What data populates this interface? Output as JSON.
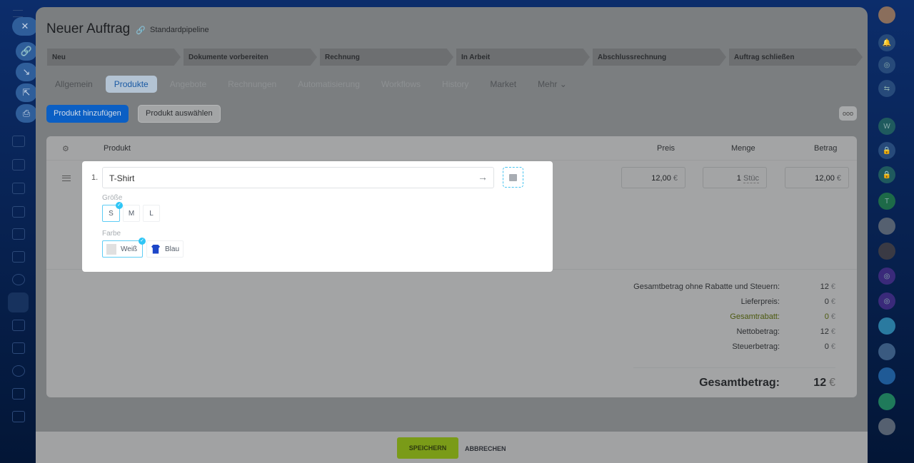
{
  "header": {
    "title": "Neuer Auftrag",
    "pipeline": "Standardpipeline"
  },
  "stages": [
    "Neu",
    "Dokumente vorbereiten",
    "Rechnung",
    "In Arbeit",
    "Abschlussrechnung",
    "Auftrag schließen"
  ],
  "tabs": [
    {
      "label": "Allgemein"
    },
    {
      "label": "Produkte"
    },
    {
      "label": "Angebote"
    },
    {
      "label": "Rechnungen"
    },
    {
      "label": "Automatisierung"
    },
    {
      "label": "Workflows"
    },
    {
      "label": "History"
    },
    {
      "label": "Market"
    },
    {
      "label": "Mehr ⌄"
    }
  ],
  "toolbar": {
    "add": "Produkt hinzufügen",
    "select": "Produkt auswählen",
    "more": "ooo"
  },
  "table": {
    "headers": {
      "product": "Produkt",
      "price": "Preis",
      "qty": "Menge",
      "amount": "Betrag"
    },
    "row": {
      "index": "1.",
      "name": "T-Shirt",
      "price": "12,00",
      "currency": "€",
      "qty": "1",
      "unit": "Stüc",
      "amount": "12,00"
    }
  },
  "variants": {
    "size_label": "Größe",
    "sizes": [
      "S",
      "M",
      "L"
    ],
    "selected_size": "S",
    "color_label": "Farbe",
    "colors": [
      "Weiß",
      "Blau"
    ],
    "selected_color": "Weiß"
  },
  "totals": {
    "rows": [
      {
        "label": "Gesamtbetrag ohne Rabatte und Steuern:",
        "value": "12"
      },
      {
        "label": "Lieferpreis:",
        "value": "0"
      },
      {
        "label": "Gesamtrabatt:",
        "value": "0"
      },
      {
        "label": "Nettobetrag:",
        "value": "12"
      },
      {
        "label": "Steuerbetrag:",
        "value": "0"
      }
    ],
    "grand_label": "Gesamtbetrag:",
    "grand_value": "12",
    "currency": "€"
  },
  "footer": {
    "save": "SPEICHERN",
    "cancel": "ABBRECHEN"
  },
  "rightbar": {
    "w": "W",
    "t": "T"
  },
  "colors": {
    "accent": "#0b5fc4",
    "save": "#7a9b18",
    "selected": "#2fc6f6"
  }
}
